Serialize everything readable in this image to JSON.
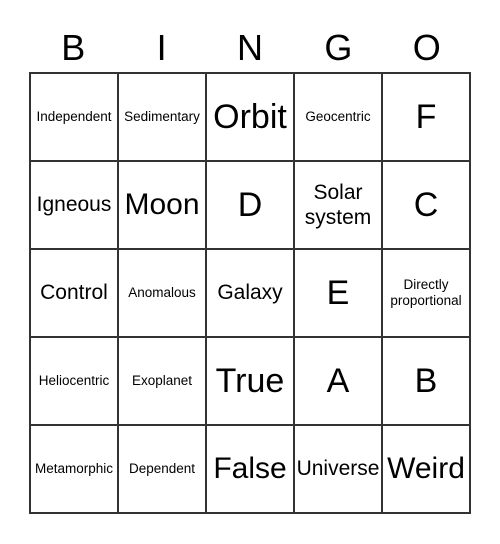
{
  "header": [
    "B",
    "I",
    "N",
    "G",
    "O"
  ],
  "cells": [
    [
      "Independent",
      "Sedimentary",
      "Orbit",
      "Geocentric",
      "F"
    ],
    [
      "Igneous",
      "Moon",
      "D",
      "Solar system",
      "C"
    ],
    [
      "Control",
      "Anomalous",
      "Galaxy",
      "E",
      "Directly proportional"
    ],
    [
      "Heliocentric",
      "Exoplanet",
      "True",
      "A",
      "B"
    ],
    [
      "Metamorphic",
      "Dependent",
      "False",
      "Universe",
      "Weird"
    ]
  ]
}
